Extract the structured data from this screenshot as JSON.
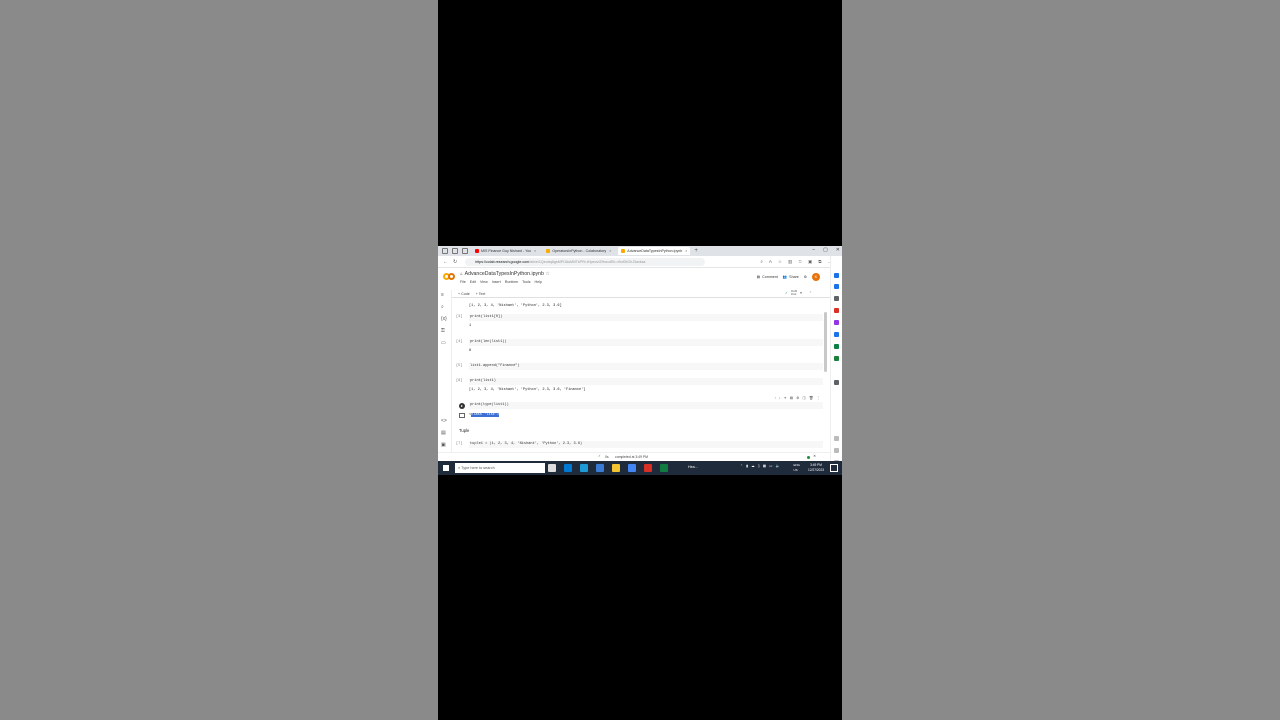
{
  "browser": {
    "tabs": [
      {
        "label": "MIS Finance Guy Nishant - You",
        "favicon_color": "#ff0000",
        "active": false
      },
      {
        "label": "OperatorsInPython - Colaboratory",
        "favicon_color": "#f9ab00",
        "active": false
      },
      {
        "label": "AdvanceDataTypesInPython.ipynb",
        "favicon_color": "#f9ab00",
        "active": true
      }
    ],
    "new_tab": "+",
    "url_host": "https://colab.research.google.com",
    "url_rest": "/drive/1Qeutrq6gsMPOAsMNTkPRr-tHpeovIZHsrcdEb-n9ufGtGhJ3axksa"
  },
  "colab": {
    "notebook_title": "AdvanceDataTypesInPython.ipynb",
    "menu": [
      "File",
      "Edit",
      "View",
      "Insert",
      "Runtime",
      "Tools",
      "Help"
    ],
    "comment_label": "Comment",
    "share_label": "Share",
    "avatar_letter": "K",
    "add_code": "+ Code",
    "add_text": "+ Text",
    "ram_label": "RAM\nDisk"
  },
  "cells": [
    {
      "prompt": "",
      "code": "",
      "output": "[1, 2, 3, 4, 'Nishant', 'Python', 2.3, 3.6]"
    },
    {
      "prompt": "[3]",
      "code": "print(list1[0])",
      "output": "1"
    },
    {
      "prompt": "[4]",
      "code": "print(len(list1))",
      "output": "8"
    },
    {
      "prompt": "[5]",
      "code": "list1.append(\"Finance\")",
      "output": ""
    },
    {
      "prompt": "[6]",
      "code": "print(list1)",
      "output": "[1, 2, 3, 4, 'Nishant', 'Python', 2.3, 3.6, 'Finance']"
    },
    {
      "prompt": "",
      "code": "print(type(list1))",
      "output_pre": "<",
      "output_sel": "class 'list'",
      "output_post": ">"
    },
    {
      "prompt": "",
      "markdown": "Tuple"
    },
    {
      "prompt": "[7]",
      "code": "tuple1 = (1, 2, 3, 4, 'Nishant', 'Python', 2.3, 3.6)"
    }
  ],
  "status": {
    "check": "✓",
    "seconds": "0s",
    "completed": "completed at 3:49 PM"
  },
  "taskbar": {
    "search_placeholder": "Type here to search",
    "tray_lang": "ENG\nUS",
    "clock_time": "3:49 PM",
    "clock_date": "12/27/2023",
    "weather": "Hea..."
  }
}
